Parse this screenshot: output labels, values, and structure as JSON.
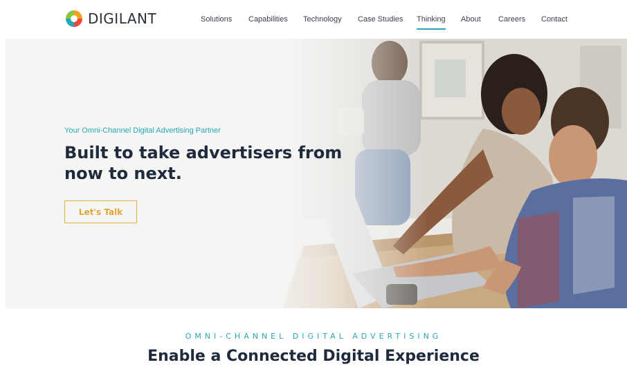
{
  "brand": {
    "name": "DIGILANT",
    "colors": {
      "accent": "#27a7b4",
      "cta": "#e0a437",
      "heading": "#1f2a3c"
    },
    "logo_icon": "digilant-ring-logo-icon"
  },
  "nav": {
    "items": [
      {
        "label": "Solutions"
      },
      {
        "label": "Capabilities"
      },
      {
        "label": "Technology"
      },
      {
        "label": "Case Studies"
      },
      {
        "label": "Thinking",
        "active": true
      },
      {
        "label": "About"
      },
      {
        "label": "Careers"
      },
      {
        "label": "Contact"
      }
    ]
  },
  "hero": {
    "eyebrow": "Your Omni-Channel Digital Advertising Partner",
    "title": "Built to take advertisers from now to next.",
    "cta_label": "Let's Talk",
    "image": "office-team-at-laptop-photo"
  },
  "section": {
    "eyebrow": "OMNI-CHANNEL DIGITAL ADVERTISING",
    "title": "Enable a Connected Digital Experience"
  }
}
